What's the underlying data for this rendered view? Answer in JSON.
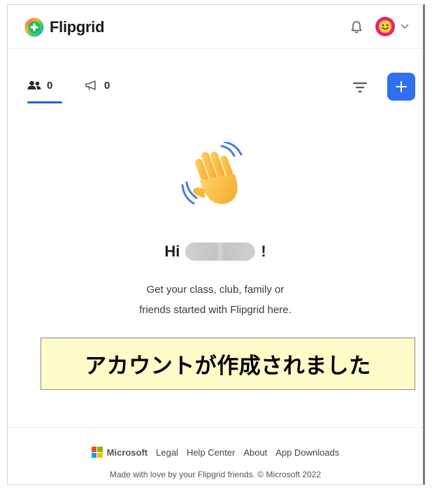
{
  "app": {
    "name": "Flipgrid"
  },
  "header": {
    "avatar_emoji": "😊"
  },
  "tabs": [
    {
      "name": "members",
      "count": "0",
      "icon": "people-icon"
    },
    {
      "name": "announcements",
      "count": "0",
      "icon": "megaphone-icon"
    }
  ],
  "toolbar": {
    "add_label": "+"
  },
  "main": {
    "greeting_prefix": "Hi",
    "greeting_suffix": "!",
    "line1": "Get your class, club, family or",
    "line2": "friends started with Flipgrid here."
  },
  "banner": {
    "text": "アカウントが作成されました"
  },
  "footer": {
    "brand": "Microsoft",
    "links": [
      "Legal",
      "Help Center",
      "About",
      "App Downloads"
    ],
    "copyright": "Made with love by your Flipgrid friends. © Microsoft 2022"
  },
  "colors": {
    "accent": "#2f6ff0",
    "banner_bg": "#fffcc9",
    "avatar": "#e8246f"
  }
}
